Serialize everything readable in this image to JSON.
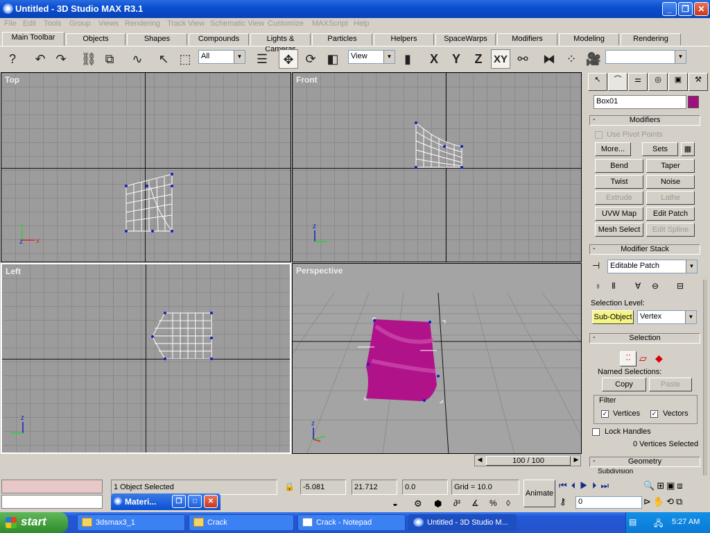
{
  "window": {
    "title": "Untitled - 3D Studio MAX R3.1"
  },
  "menu": [
    "File",
    "Edit",
    "Tools",
    "Group",
    "Views",
    "Rendering",
    "Track View",
    "Schematic View",
    "Customize",
    "MAXScript",
    "Help"
  ],
  "tabs": [
    "Main Toolbar",
    "Objects",
    "Shapes",
    "Compounds",
    "Lights & Cameras",
    "Particles",
    "Helpers",
    "SpaceWarps",
    "Modifiers",
    "Modeling",
    "Rendering"
  ],
  "toolbar": {
    "filter_value": "All",
    "coord_value": "View",
    "x_label": "X",
    "y_label": "Y",
    "z_label": "Z",
    "xy_label": "XY"
  },
  "viewports": {
    "top": "Top",
    "front": "Front",
    "left": "Left",
    "perspective": "Perspective",
    "axis_x": "x",
    "axis_y": "y",
    "axis_z": "z"
  },
  "panel": {
    "object_name": "Box01",
    "object_color": "#a0107a",
    "modifiers_header": "Modifiers",
    "use_pivot": "Use Pivot Points",
    "more": "More...",
    "sets": "Sets",
    "buttons": [
      "Bend",
      "Taper",
      "Twist",
      "Noise",
      "Extrude",
      "Lathe",
      "UVW Map",
      "Edit Patch",
      "Mesh Select",
      "Edit Spline"
    ],
    "disabled": [
      "Extrude",
      "Lathe",
      "Edit Spline"
    ],
    "stack_header": "Modifier Stack",
    "stack_value": "Editable Patch",
    "selection_level": "Selection Level:",
    "sub_object": "Sub-Object",
    "level_value": "Vertex",
    "selection_header": "Selection",
    "named_selections": "Named Selections:",
    "copy": "Copy",
    "paste": "Paste",
    "filter": "Filter",
    "vertices": "Vertices",
    "vectors": "Vectors",
    "lock_handles": "Lock Handles",
    "selected_count": "0 Vertices Selected",
    "geometry_header": "Geometry",
    "subdivision": "Subdivision"
  },
  "timeline": {
    "frame": "100 / 100"
  },
  "status": {
    "objects_selected": "1 Object Selected",
    "x": "-5.081",
    "y": "21.712",
    "z": "0.0",
    "grid": "Grid = 10.0",
    "animate": "Animate",
    "frame_value": "0",
    "material_editor": "Materi..."
  },
  "taskbar": {
    "start": "start",
    "tasks": [
      "3dsmax3_1",
      "Crack",
      "Crack - Notepad",
      "Untitled - 3D Studio M..."
    ],
    "time": "5:27 AM"
  },
  "colors": {
    "accent": "#0a4fd0",
    "mesh": "#a0107a",
    "viewport": "#9c9c9c"
  }
}
